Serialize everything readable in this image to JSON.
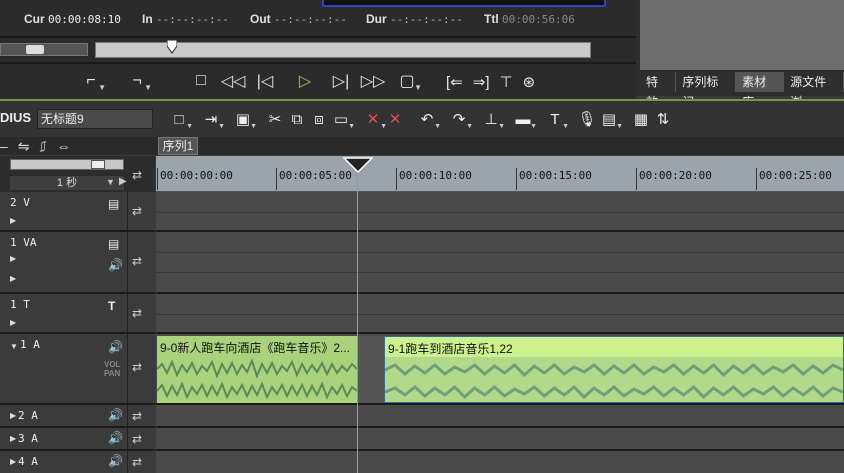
{
  "recorder": {
    "cur_label": "Cur",
    "cur_value": "00:00:08:10",
    "in_label": "In",
    "in_value": "--:--:--:--",
    "out_label": "Out",
    "out_value": "--:--:--:--",
    "dur_label": "Dur",
    "dur_value": "--:--:--:--",
    "ttl_label": "Ttl",
    "ttl_value": "00:00:56:06",
    "playback_position": 0.155
  },
  "transport_icons": [
    "mark-in-icon",
    "mark-out-icon",
    "stop-icon",
    "rewind-icon",
    "step-back-icon",
    "play-icon",
    "step-forward-icon",
    "fast-forward-icon",
    "loop-icon"
  ],
  "right_panel": {
    "tabs": [
      "特效",
      "序列标记",
      "素材库",
      "源文件浏"
    ],
    "active_tab": 2
  },
  "project": {
    "app_logo": "DIUS",
    "name": "无标题9"
  },
  "sequence_tab": "序列1",
  "zoom": {
    "label": "1 秒"
  },
  "ruler": {
    "labels": [
      "00:00:00:00",
      "00:00:05:00",
      "00:00:10:00",
      "00:00:15:00",
      "00:00:20:00",
      "00:00:25:00"
    ]
  },
  "tracks": [
    {
      "name": "2 V",
      "type": "video"
    },
    {
      "name": "1 VA",
      "type": "video-audio"
    },
    {
      "name": "1 T",
      "type": "title"
    },
    {
      "name": "1 A",
      "type": "audio",
      "expanded": true,
      "vol_label": "VOL",
      "pan_label": "PAN"
    },
    {
      "name": "2 A",
      "type": "audio"
    },
    {
      "name": "3 A",
      "type": "audio"
    },
    {
      "name": "4 A",
      "type": "audio"
    }
  ],
  "clips": [
    {
      "title": "9-0新人跑车向酒店《跑车音乐》2...",
      "track": "1 A",
      "selected": false
    },
    {
      "title": "9-1跑车到酒店音乐1,22",
      "track": "1 A",
      "selected": true
    }
  ],
  "colors": {
    "clip": "#aad27a",
    "clip_selected": "#cdf08c",
    "playhead": "#5ab4b4",
    "ruler": "#9aa4aa",
    "accent_line": "#6a9a4a"
  }
}
